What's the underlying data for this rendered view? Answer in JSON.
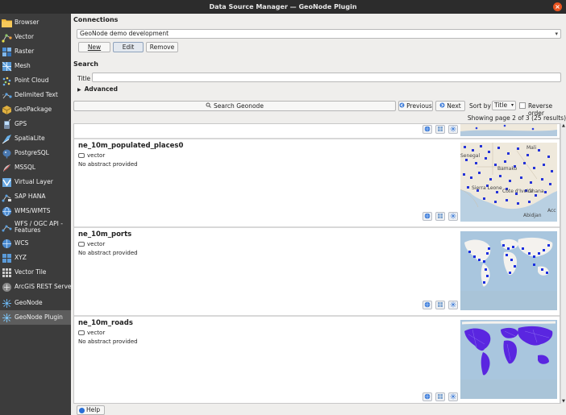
{
  "window": {
    "title": "Data Source Manager — GeoNode Plugin",
    "close_glyph": "×"
  },
  "sidebar": {
    "items": [
      {
        "label": "Browser",
        "icon": "folder-icon"
      },
      {
        "label": "Vector",
        "icon": "vector-icon"
      },
      {
        "label": "Raster",
        "icon": "raster-icon"
      },
      {
        "label": "Mesh",
        "icon": "mesh-icon"
      },
      {
        "label": "Point Cloud",
        "icon": "point-cloud-icon"
      },
      {
        "label": "Delimited Text",
        "icon": "delimited-text-icon"
      },
      {
        "label": "GeoPackage",
        "icon": "geopackage-icon"
      },
      {
        "label": "GPS",
        "icon": "gps-icon"
      },
      {
        "label": "SpatiaLite",
        "icon": "spatialite-icon"
      },
      {
        "label": "PostgreSQL",
        "icon": "postgresql-icon"
      },
      {
        "label": "MSSQL",
        "icon": "mssql-icon"
      },
      {
        "label": "Virtual Layer",
        "icon": "virtual-layer-icon"
      },
      {
        "label": "SAP HANA",
        "icon": "sap-hana-icon"
      },
      {
        "label": "WMS/WMTS",
        "icon": "wms-icon"
      },
      {
        "label": "WFS / OGC API - Features",
        "icon": "wfs-icon"
      },
      {
        "label": "WCS",
        "icon": "wcs-icon"
      },
      {
        "label": "XYZ",
        "icon": "xyz-icon"
      },
      {
        "label": "Vector Tile",
        "icon": "vector-tile-icon"
      },
      {
        "label": "ArcGIS REST Server",
        "icon": "arcgis-icon"
      },
      {
        "label": "GeoNode",
        "icon": "geonode-icon"
      },
      {
        "label": "GeoNode Plugin",
        "icon": "geonode-plugin-icon",
        "active": true
      }
    ]
  },
  "connections": {
    "heading": "Connections",
    "selected": "GeoNode demo development",
    "buttons": {
      "new": "New",
      "edit": "Edit",
      "remove": "Remove"
    }
  },
  "search": {
    "heading": "Search",
    "title_label": "Title",
    "title_value": "",
    "advanced_label": "Advanced",
    "search_button": "Search Geonode",
    "previous_button": "Previous",
    "next_button": "Next",
    "sort_label": "Sort by",
    "sort_value": "Title",
    "reverse_label": "Reverse order",
    "page_status": "Showing page 2 of 3 (25 results)"
  },
  "results": [
    {
      "name": "ne_10m_populated_places0",
      "type": "vector",
      "abstract": "No abstract provided"
    },
    {
      "name": "ne_10m_ports",
      "type": "vector",
      "abstract": "No abstract provided"
    },
    {
      "name": "ne_10m_roads",
      "type": "vector",
      "abstract": "No abstract provided"
    }
  ],
  "thumb_labels": [
    "Mali",
    "Senegal",
    "Bamako",
    "Sierra Leone",
    "Côte d'Ivoire",
    "Ghana",
    "Abidjan",
    "Acc"
  ],
  "help_button": "Help",
  "colors": {
    "accent": "#2a6fd6",
    "sidebar_bg": "#3c3c3c",
    "close": "#e95420"
  }
}
